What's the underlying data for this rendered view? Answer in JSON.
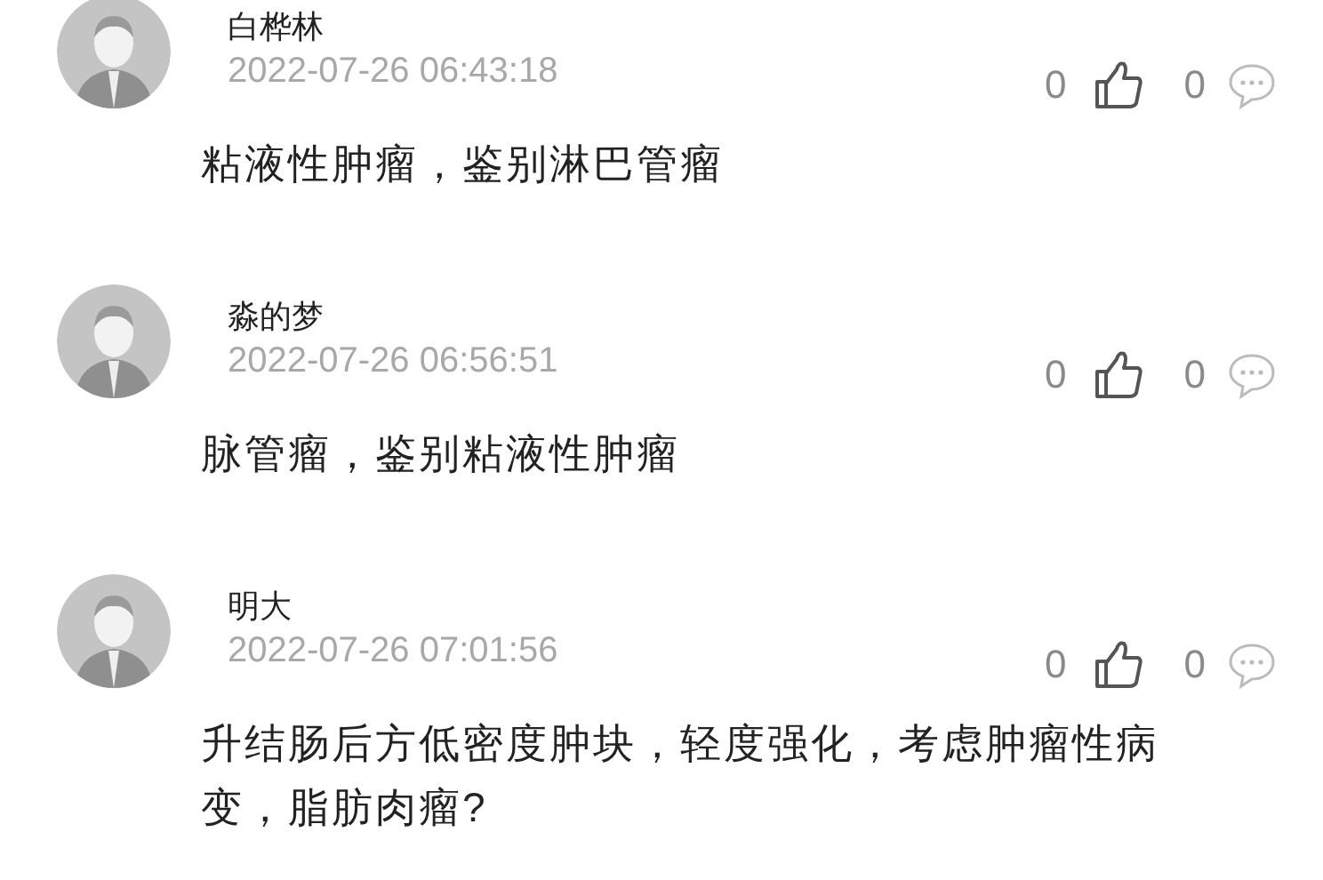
{
  "comments": [
    {
      "name": "白桦林",
      "time": "2022-07-26 06:43:18",
      "likes": "0",
      "replies": "0",
      "content": "粘液性肿瘤，鉴别淋巴管瘤"
    },
    {
      "name": "淼的梦",
      "time": "2022-07-26 06:56:51",
      "likes": "0",
      "replies": "0",
      "content": "脉管瘤，鉴别粘液性肿瘤"
    },
    {
      "name": "明大",
      "time": "2022-07-26 07:01:56",
      "likes": "0",
      "replies": "0",
      "content": "升结肠后方低密度肿块，轻度强化，考虑肿瘤性病变，脂肪肉瘤?"
    }
  ]
}
